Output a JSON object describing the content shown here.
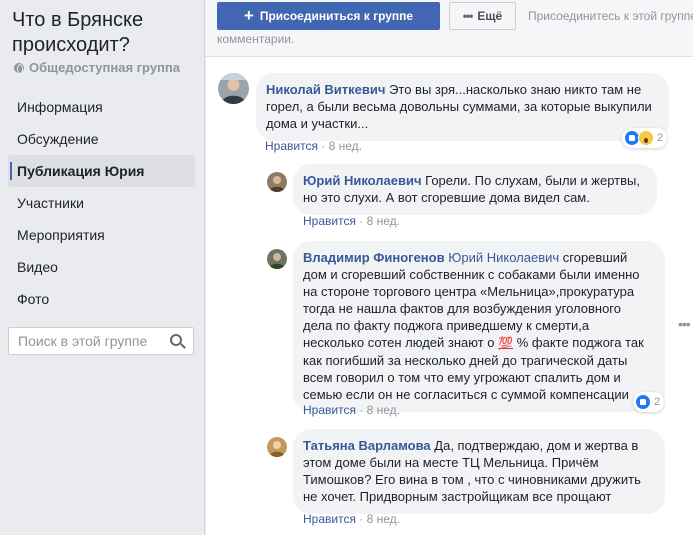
{
  "group": {
    "title": "Что в Брянске происходит?",
    "type_label": "Общедоступная группа",
    "type_icon": "globe-icon"
  },
  "nav": {
    "items": [
      {
        "label": "Информация",
        "active": false
      },
      {
        "label": "Обсуждение",
        "active": false
      },
      {
        "label": "Публикация Юрия",
        "active": true
      },
      {
        "label": "Участники",
        "active": false
      },
      {
        "label": "Мероприятия",
        "active": false
      },
      {
        "label": "Видео",
        "active": false
      },
      {
        "label": "Фото",
        "active": false
      }
    ],
    "search_placeholder": "Поиск в этой группе"
  },
  "topbar": {
    "join_label": "Присоединиться к группе",
    "more_label": "Ещё",
    "hint_line1": "Присоединитесь к этой группе",
    "hint_line2": "комментарии."
  },
  "comments": [
    {
      "author": "Николай Виткевич",
      "text": "Это вы зря...насколько знаю никто там не горел, а были весьма довольны суммами, за которые выкупили дома и участки...",
      "like_label": "Нравится",
      "time": "8 нед.",
      "reactions": {
        "count": "2",
        "icons": [
          "like-icon",
          "wow-icon"
        ]
      }
    },
    {
      "author": "Юрий Николаевич",
      "text": "Горели. По слухам, были и жертвы, но это слухи. А вот сгоревшие дома видел сам.",
      "like_label": "Нравится",
      "time": "8 нед."
    },
    {
      "author": "Владимир Финогенов",
      "mention": "Юрий Николаевич",
      "text_before_emoji": "сгоревший дом и сгоревший собственник с собаками были именно на стороне торгового центра «Мельница»,прокуратура тогда не нашла фактов для возбуждения уголовного дела по факту поджога приведшему к смерти,а несколько сотен людей знают о",
      "emoji": "💯",
      "text_after_emoji": "% факте поджога так как погибший за несколько дней до трагической даты всем говорил о том что ему угрожают спалить дом и семью если он не согласиться с суммой компенсации",
      "like_label": "Нравится",
      "time": "8 нед.",
      "reactions": {
        "count": "2",
        "icons": [
          "like-icon"
        ]
      }
    },
    {
      "author": "Татьяна Варламова",
      "text": "Да, подтверждаю, дом и жертва в этом доме были на месте ТЦ Мельница. Причём Тимошков? Его вина в том , что с чиновниками дружить не хочет. Придворным застройщикам все прощают",
      "like_label": "Нравится",
      "time": "8 нед."
    }
  ],
  "colors": {
    "accent": "#4267b2",
    "link": "#385898",
    "sidebar_bg": "#e9ebee",
    "bubble_bg": "#f2f3f5"
  }
}
